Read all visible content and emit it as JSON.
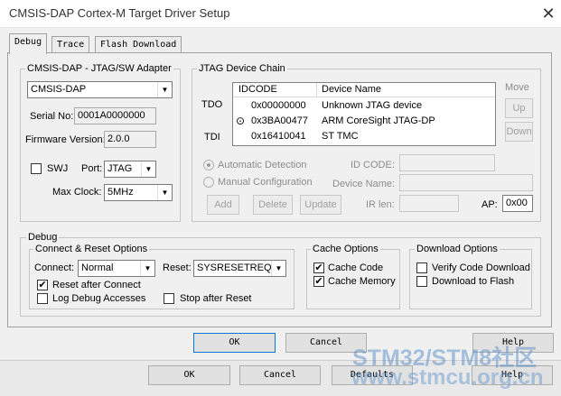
{
  "window": {
    "title": "CMSIS-DAP Cortex-M Target Driver Setup",
    "close_glyph": "✕"
  },
  "tabs": [
    {
      "label": "Debug",
      "active": true
    },
    {
      "label": "Trace",
      "active": false
    },
    {
      "label": "Flash Download",
      "active": false
    }
  ],
  "adapter": {
    "title": "CMSIS-DAP - JTAG/SW Adapter",
    "selected": "CMSIS-DAP",
    "serial_label": "Serial No:",
    "serial_value": "0001A0000000",
    "firmware_label": "Firmware Version:",
    "firmware_value": "2.0.0",
    "swj_label": "SWJ",
    "swj_checked": false,
    "port_label": "Port:",
    "port_value": "JTAG",
    "max_clock_label": "Max Clock:",
    "max_clock_value": "5MHz"
  },
  "jtag_chain": {
    "title": "JTAG Device Chain",
    "tdo_label": "TDO",
    "tdi_label": "TDI",
    "columns": [
      "IDCODE",
      "Device Name"
    ],
    "rows": [
      {
        "idcode": "0x00000000",
        "device": "Unknown JTAG device",
        "selected": false
      },
      {
        "idcode": "0x3BA00477",
        "device": "ARM CoreSight JTAG-DP",
        "selected": true
      },
      {
        "idcode": "0x16410041",
        "device": "ST TMC",
        "selected": false
      }
    ],
    "selected_glyph": "⊙",
    "move_label": "Move",
    "up_label": "Up",
    "down_label": "Down",
    "auto_detect_label": "Automatic Detection",
    "manual_config_label": "Manual Configuration",
    "id_code_label": "ID CODE:",
    "device_name_label": "Device Name:",
    "add_label": "Add",
    "delete_label": "Delete",
    "update_label": "Update",
    "ir_len_label": "IR len:",
    "ap_label": "AP:",
    "ap_value": "0x00"
  },
  "debug": {
    "title": "Debug",
    "connect_reset": {
      "title": "Connect & Reset Options",
      "connect_label": "Connect:",
      "connect_value": "Normal",
      "reset_label": "Reset:",
      "reset_value": "SYSRESETREQ",
      "reset_after_connect_label": "Reset after Connect",
      "reset_after_connect": true,
      "log_debug_label": "Log Debug Accesses",
      "log_debug": false,
      "stop_after_reset_label": "Stop after Reset",
      "stop_after_reset": false
    },
    "cache": {
      "title": "Cache Options",
      "cache_code_label": "Cache Code",
      "cache_code": true,
      "cache_memory_label": "Cache Memory",
      "cache_memory": true
    },
    "download": {
      "title": "Download Options",
      "verify_label": "Verify Code Download",
      "verify": false,
      "download_flash_label": "Download to Flash",
      "download_flash": false
    }
  },
  "buttons_inner": {
    "ok": "OK",
    "cancel": "Cancel",
    "help": "Help"
  },
  "buttons_outer": {
    "ok": "OK",
    "cancel": "Cancel",
    "defaults": "Defaults",
    "help": "Help"
  },
  "checkmark_glyph": "✔",
  "dropdown_glyph": "▼",
  "watermark": {
    "line1": "STM32/STM8社区",
    "line2": "www.stmcu.org.cn"
  },
  "colors": {
    "watermark_top": "#5b8fc7",
    "watermark_bottom": "#6a9ad0",
    "focus_blue": "#0078d7"
  }
}
